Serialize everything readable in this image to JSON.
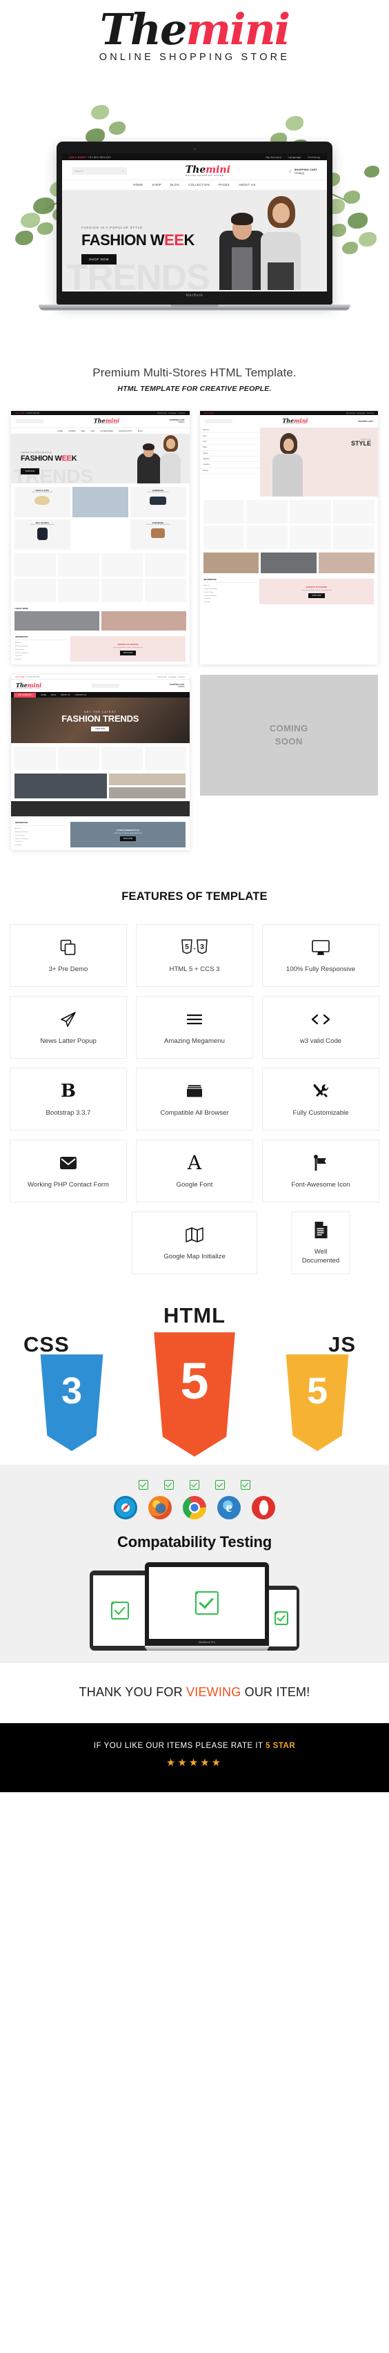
{
  "brand": {
    "name_dark": "The",
    "name_red": "mini",
    "tagline": "ONLINE SHOPPING STORE"
  },
  "hero_site": {
    "call_now": "CALL NOW !",
    "phone": "+91 801-654-331",
    "account": "My Account",
    "language": "Language",
    "currency": "Currency",
    "search_placeholder": "Search",
    "cart_label": "SHOPPING CART",
    "cart_value": "ITEM(0)",
    "nav": [
      "HOME",
      "SHOP",
      "BLOG",
      "COLLECTION",
      "PAGES",
      "ABOUT US"
    ],
    "slide_kicker": "FASHION IS A POPULAR STYLE",
    "slide_title_a": "FASHION W",
    "slide_title_red": "EE",
    "slide_title_b": "K",
    "slide_button": "SHOP NOW",
    "ghost_word": "TRENDS",
    "laptop_label": "MacBook"
  },
  "tagline": {
    "main": "Premium Multi-Stores HTML Template.",
    "sub": "HTML TEMPLATE FOR CREATIVE PEOPLE."
  },
  "previews": {
    "shot1": {
      "nav": [
        "HOME",
        "WOMEN",
        "MEN",
        "KIDS",
        "ACCESSORIES",
        "FASHION GIFTS",
        "BLOG"
      ],
      "kicker": "TRENDS IS A POPULAR STYLE",
      "title_a": "FASHION W",
      "title_red": "EE",
      "title_b": "K",
      "button": "SHOP NOW",
      "ghost": "TRENDS",
      "tiles": [
        {
          "title": "HATS & CAPS",
          "sub": "NEW TRENDY IN THIS STYLES"
        },
        {
          "title": "HANDBAGS",
          "sub": "DISCOVER BAG IN WOMEN 2021"
        },
        {
          "title": "BUY SCARFS",
          "sub": "MORE COLLECTIONS OF SEASONS"
        },
        {
          "title": "FOOTWARE",
          "sub": "START BUY LUXURY ACCESSORIES"
        }
      ],
      "blog_head": "LATEST NEWS",
      "footer_col": "INFORMATION",
      "footer_links": [
        "About Us",
        "Delivery Information",
        "Privacy Policy",
        "Terms & Conditions",
        "Contact Us",
        "Site Map"
      ],
      "promo_title": "EXPERTS IN FASHION",
      "promo_sub": "Lorem ipsum dolor sit amet, consectetuer elit",
      "promo_btn": "SHOP NOW"
    },
    "shot2": {
      "side_items": [
        "Women",
        "Men",
        "Kids",
        "Bags",
        "Shoes",
        "Watches",
        "Jewellery",
        "Beauty"
      ],
      "badge_small": "POPULAR",
      "badge_big": "STYLE",
      "footer_col": "INFORMATION",
      "footer_links": [
        "About Us",
        "Delivery Information",
        "Privacy Policy",
        "Terms & Conditions",
        "Contact Us",
        "Site Map"
      ]
    },
    "shot3": {
      "cat_button": "TOP CATEGORY",
      "nav": [
        "HOME",
        "BLOG",
        "ABOUT US",
        "CONTACT US"
      ],
      "hero_kicker": "GET THE LATEST",
      "hero_title": "FASHION TRENDS",
      "hero_button": "SHOP NOW",
      "footer_col": "INFORMATION",
      "promo_title": "LATEST FASHION STYLE",
      "promo_sub": "SERIOUS CLOTHING GEAR FASHIONS",
      "promo_btn": "SHOP NOW"
    },
    "coming_soon": "COMING\nSOON"
  },
  "features": {
    "heading": "FEATURES OF  TEMPLATE",
    "items": [
      {
        "icon": "copy-layers-icon",
        "label": "3+ Pre Demo"
      },
      {
        "icon": "html5-css3-icon",
        "label": "HTML 5 + CCS 3"
      },
      {
        "icon": "monitor-icon",
        "label": "100% Fully Responsive"
      },
      {
        "icon": "paper-plane-icon",
        "label": "News Latter Popup"
      },
      {
        "icon": "hamburger-menu-icon",
        "label": "Amazing Megamenu"
      },
      {
        "icon": "code-brackets-icon",
        "label": "w3 valid Code"
      },
      {
        "icon": "bootstrap-b-icon",
        "label": "Bootstrap 3.3.7"
      },
      {
        "icon": "browser-window-icon",
        "label": "Compatible All Browser"
      },
      {
        "icon": "tools-icon",
        "label": "Fully Customizable"
      },
      {
        "icon": "envelope-icon",
        "label": "Working PHP Contact Form"
      },
      {
        "icon": "letter-a-icon",
        "label": "Google Font"
      },
      {
        "icon": "flag-icon",
        "label": "Font-Awesome Icon"
      },
      {
        "icon": "map-icon",
        "label": "Google Map Initialize"
      },
      {
        "icon": "document-icon",
        "label": "Well Documented"
      }
    ]
  },
  "stack": {
    "html_word": "HTML",
    "css_word": "CSS",
    "js_word": "JS",
    "html_badge": "5",
    "css_badge": "3",
    "js_badge": "5",
    "html_color": "#f1562a",
    "css_color": "#2f8fd4",
    "js_color": "#f6b333"
  },
  "compat": {
    "title": "Compatability Testing",
    "browsers": [
      "safari-icon",
      "firefox-icon",
      "chrome-icon",
      "internet-explorer-icon",
      "opera-icon"
    ],
    "laptop_label": "MacBook Pro",
    "check_color": "#27ae34"
  },
  "footer": {
    "thanks_a": "THANK YOU FOR ",
    "thanks_hl": "VIEWING",
    "thanks_b": " OUR ITEM!",
    "rate_a": "IF YOU LIKE OUR ITEMS PLEASE RATE IT ",
    "rate_hl": "5 STAR",
    "stars": "★★★★★",
    "accent": "#f2501a",
    "gold": "#f5a623"
  }
}
